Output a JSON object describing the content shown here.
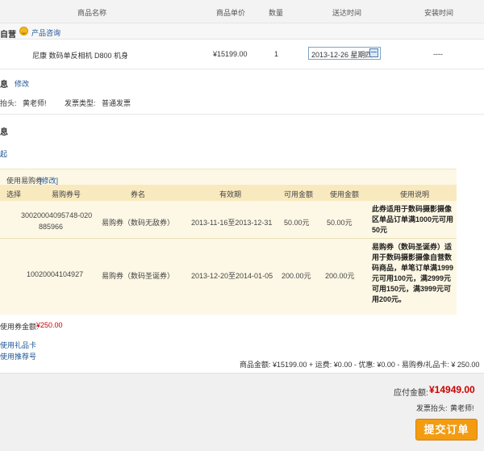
{
  "header": {
    "col_name": "商品名称",
    "col_price": "商品单价",
    "col_qty": "数量",
    "col_delivery": "送达时间",
    "col_install": "安装时间"
  },
  "store": {
    "label": "自营",
    "consult_link": "产品咨询"
  },
  "product": {
    "name": "尼康 数码单反相机 D800 机身",
    "price": "¥15199.00",
    "qty": "1",
    "delivery_date": "2013-12-26 星期四",
    "install_time": "----"
  },
  "invoice": {
    "section_label": "息",
    "edit_link": "修改",
    "title_label": "抬头:",
    "title_value": "黄老师!",
    "type_label": "发票类型:",
    "type_value": "普通发票"
  },
  "coupon_section": {
    "section_label": "息",
    "collapse_link": "起",
    "use_coupon_label": "使用易购券",
    "edit_link": "[修改]",
    "columns": [
      "选择",
      "易购券号",
      "券名",
      "有效期",
      "可用金额",
      "使用金额",
      "使用说明"
    ],
    "rows": [
      {
        "number_line1": "30020004095748-020",
        "number_line2": "885966",
        "name": "易购券（数码无敌券）",
        "validity": "2013-11-16至2013-12-31",
        "available": "50.00元",
        "used": "50.00元",
        "desc_lines": [
          "此券适用于数码摄影摄像",
          "区单品订单满1000元可用",
          "50元"
        ]
      },
      {
        "number_line1": "10020004104927",
        "number_line2": "",
        "name": "易购券（数码圣诞券）",
        "validity": "2013-12-20至2014-01-05",
        "available": "200.00元",
        "used": "200.00元",
        "desc_lines": [
          "易购券（数码圣诞券）适",
          "用于数码摄影摄像自营数",
          "码商品，单笔订单满1999",
          "元可用100元，满2999元",
          "可用150元，满3999元可",
          "用200元。"
        ]
      }
    ],
    "total_label": "使用券金额:",
    "total_value": "¥250.00",
    "gift_card_link": "使用礼品卡",
    "tuijian_link": "使用推荐号"
  },
  "summary": {
    "line": "商品金额: ¥15199.00 + 运费: ¥0.00 - 优惠: ¥0.00 - 易购券/礼品卡: ¥ 250.00",
    "payable_label": "应付金额:",
    "payable_value": "¥14949.00",
    "invoice_title_label": "发票抬头:",
    "invoice_title_value": "黄老师!",
    "submit_label": "提交订单"
  },
  "colors": {
    "accent_red": "#cc0000",
    "link_blue": "#1e5494",
    "submit_orange": "#f39c12",
    "coupon_bg": "#fdf8e5"
  }
}
